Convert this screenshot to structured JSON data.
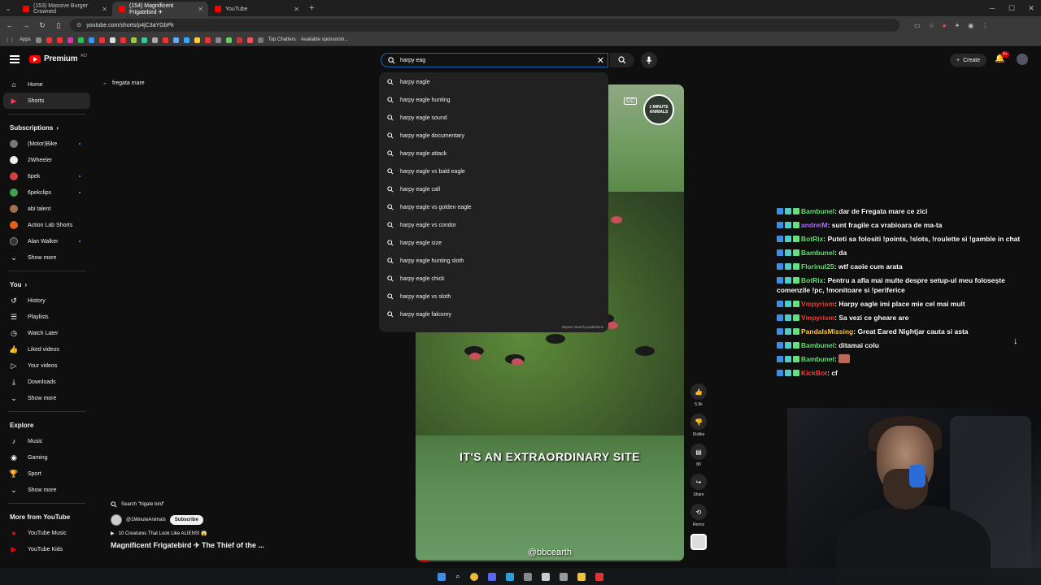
{
  "browser": {
    "tabs": [
      {
        "title": "(153) Massive Burger Crowned",
        "active": false
      },
      {
        "title": "(154) Magnificent Frigatebird ✈",
        "active": true
      },
      {
        "title": "YouTube",
        "active": false
      }
    ],
    "url": "youtube.com/shorts/p4jC3aYGbPk",
    "bookmarks": [
      "Apps",
      "Top Chatters",
      "Available sponsorsh..."
    ]
  },
  "header": {
    "logo_text": "Premium",
    "logo_sup": "RO",
    "search_value": "harpy eag",
    "create_label": "Create",
    "notif_count": "9+"
  },
  "sidebar": {
    "main": [
      {
        "label": "Home",
        "icon": "home-icon"
      },
      {
        "label": "Shorts",
        "icon": "shorts-icon",
        "active": true
      }
    ],
    "subs_heading": "Subscriptions",
    "subs": [
      {
        "label": "(Motor)Bike",
        "dot": true,
        "color": "#777"
      },
      {
        "label": "2Wheeler",
        "dot": false,
        "color": "#eee"
      },
      {
        "label": "6pek",
        "dot": true,
        "color": "#d04040"
      },
      {
        "label": "6pekclips",
        "dot": true,
        "color": "#40a050"
      },
      {
        "label": "abi talent",
        "dot": false,
        "color": "#a07050"
      },
      {
        "label": "Action Lab Shorts",
        "dot": false,
        "color": "#e06020"
      },
      {
        "label": "Alan Walker",
        "dot": true,
        "color": "#333"
      }
    ],
    "show_more": "Show more",
    "you_heading": "You",
    "you": [
      {
        "label": "History",
        "icon": "history-icon"
      },
      {
        "label": "Playlists",
        "icon": "playlists-icon"
      },
      {
        "label": "Watch Later",
        "icon": "watch-later-icon"
      },
      {
        "label": "Liked videos",
        "icon": "like-icon"
      },
      {
        "label": "Your videos",
        "icon": "your-videos-icon"
      },
      {
        "label": "Downloads",
        "icon": "download-icon"
      }
    ],
    "explore_heading": "Explore",
    "explore": [
      {
        "label": "Music",
        "icon": "music-icon"
      },
      {
        "label": "Gaming",
        "icon": "gaming-icon"
      },
      {
        "label": "Sport",
        "icon": "trophy-icon"
      }
    ],
    "more_heading": "More from YouTube",
    "more": [
      {
        "label": "YouTube Music"
      },
      {
        "label": "YouTube Kids"
      }
    ]
  },
  "back_label": "fregata mare",
  "suggestions": [
    "harpy eagle",
    "harpy eagle hunting",
    "harpy eagle sound",
    "harpy eagle documentary",
    "harpy eagle attack",
    "harpy eagle vs bald eagle",
    "harpy eagle call",
    "harpy eagle vs golden eagle",
    "harpy eagle vs condor",
    "harpy eagle size",
    "harpy eagle hunting sloth",
    "harpy eagle chick",
    "harpy eagle vs sloth",
    "harpy eagle falconry"
  ],
  "report_label": "Report search predictions",
  "video": {
    "caption": "IT'S AN EXTRAORDINARY SITE",
    "handle": "@bbcearth",
    "channel_badge": "1 MINUTE ANIMALS",
    "cc": "CC",
    "progress": 0.05
  },
  "actions": [
    {
      "icon": "like-icon",
      "label": "5.9k"
    },
    {
      "icon": "dislike-icon",
      "label": "Dislike"
    },
    {
      "icon": "comment-icon",
      "label": "80"
    },
    {
      "icon": "share-icon",
      "label": "Share"
    },
    {
      "icon": "remix-icon",
      "label": "Remix"
    }
  ],
  "below": {
    "search_chip": "Search \"frigate bird\"",
    "channel": "@1MinuteAnimals",
    "subscribe": "Subscribe",
    "related": "10 Creatures That Look Like ALIENS! 😱",
    "title": "Magnificent Frigatebird ✈ The Thief of the ..."
  },
  "chat": [
    {
      "nick": "Bambunel",
      "color": "green",
      "text": "dar de Fregata mare ce zici"
    },
    {
      "nick": "andreiM",
      "color": "purple",
      "text": "sunt fragile ca vrabioara de ma-ta"
    },
    {
      "nick": "BotRix",
      "color": "green",
      "text": "Puteti sa folositi !points, !slots, !roulette si !gamble in chat"
    },
    {
      "nick": "Bambunel",
      "color": "green",
      "text": "da"
    },
    {
      "nick": "Florinul25",
      "color": "green",
      "text": "wtf caoie cum arata"
    },
    {
      "nick": "BotRix",
      "color": "green",
      "text": "Pentru a afla mai multe despre setup-ul meu folosește comenzile !pc, !monitoare si !periferice"
    },
    {
      "nick": "Vmpyrism",
      "color": "red",
      "text": "Harpy eagle imi place mie cel mai mult"
    },
    {
      "nick": "Vmpyrism",
      "color": "red",
      "text": "Sa vezi ce gheare are"
    },
    {
      "nick": "PandaIsMissing",
      "color": "yellow",
      "text": "Great Eared Nightjar cauta si asta"
    },
    {
      "nick": "Bambunel",
      "color": "green",
      "text": "ditamai colu"
    },
    {
      "nick": "Bambunel",
      "color": "green",
      "text": ""
    },
    {
      "nick": "KickBot",
      "color": "red",
      "text": "cf"
    }
  ]
}
